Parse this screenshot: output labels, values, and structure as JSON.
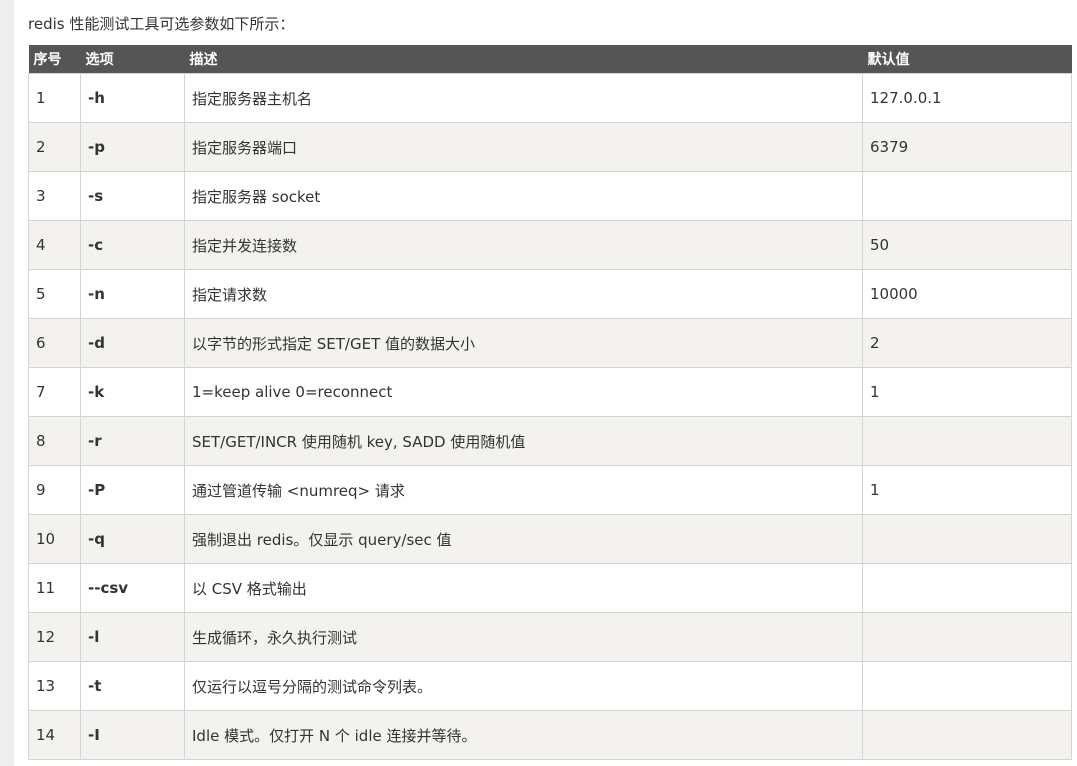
{
  "intro": "redis 性能测试工具可选参数如下所示：",
  "table": {
    "headers": {
      "index": "序号",
      "option": "选项",
      "description": "描述",
      "default": "默认值"
    },
    "rows": [
      {
        "index": "1",
        "option": "-h",
        "description": "指定服务器主机名",
        "default": "127.0.0.1"
      },
      {
        "index": "2",
        "option": "-p",
        "description": "指定服务器端口",
        "default": "6379"
      },
      {
        "index": "3",
        "option": "-s",
        "description": "指定服务器 socket",
        "default": ""
      },
      {
        "index": "4",
        "option": "-c",
        "description": "指定并发连接数",
        "default": "50"
      },
      {
        "index": "5",
        "option": "-n",
        "description": "指定请求数",
        "default": "10000"
      },
      {
        "index": "6",
        "option": "-d",
        "description": "以字节的形式指定 SET/GET 值的数据大小",
        "default": "2"
      },
      {
        "index": "7",
        "option": "-k",
        "description": "1=keep alive 0=reconnect",
        "default": "1"
      },
      {
        "index": "8",
        "option": "-r",
        "description": "SET/GET/INCR 使用随机 key, SADD 使用随机值",
        "default": ""
      },
      {
        "index": "9",
        "option": "-P",
        "description": "通过管道传输 <numreq> 请求",
        "default": "1"
      },
      {
        "index": "10",
        "option": "-q",
        "description": "强制退出 redis。仅显示 query/sec 值",
        "default": ""
      },
      {
        "index": "11",
        "option": "--csv",
        "description": "以 CSV 格式输出",
        "default": ""
      },
      {
        "index": "12",
        "option": "-l",
        "description": "生成循环，永久执行测试",
        "default": ""
      },
      {
        "index": "13",
        "option": "-t",
        "description": "仅运行以逗号分隔的测试命令列表。",
        "default": ""
      },
      {
        "index": "14",
        "option": "-I",
        "description": "Idle 模式。仅打开 N 个 idle 连接并等待。",
        "default": ""
      }
    ]
  }
}
